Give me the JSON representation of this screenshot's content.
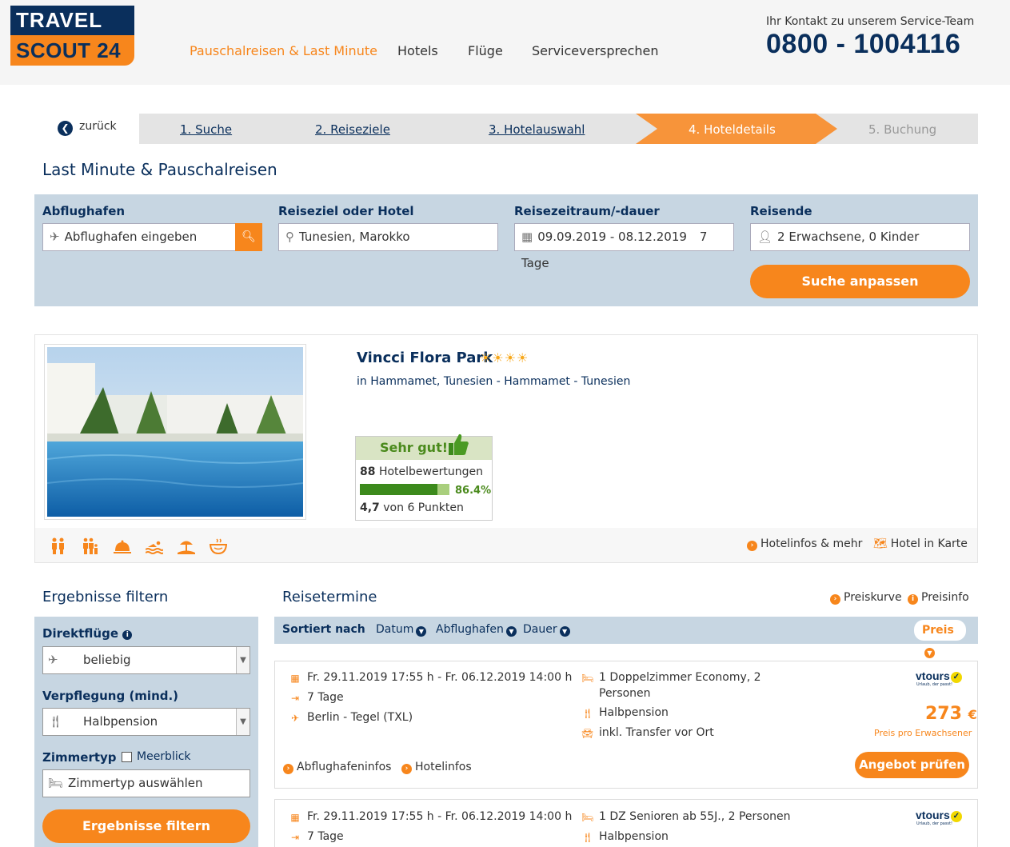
{
  "header": {
    "logo_top": "TRAVEL",
    "logo_bottom": "SCOUT 24",
    "nav": [
      "Pauschalreisen & Last Minute",
      "Hotels",
      "Flüge",
      "Serviceversprechen"
    ],
    "contact_label": "Ihr Kontakt zu unserem Service-Team",
    "contact_phone": "0800 - 1004116"
  },
  "steps": {
    "back_label": "zurück",
    "items": [
      "1. Suche",
      "2. Reiseziele",
      "3. Hotelauswahl",
      "4. Hoteldetails",
      "5. Buchung"
    ],
    "active_index": 3
  },
  "page_title": "Last Minute & Pauschalreisen",
  "search": {
    "departure_label": "Abflughafen",
    "departure_placeholder": "Abflughafen eingeben",
    "destination_label": "Reiseziel oder Hotel",
    "destination_value": "Tunesien, Marokko",
    "period_label": "Reisezeitraum/-dauer",
    "period_value": "09.09.2019 - 08.12.2019",
    "duration_value": "7 Tage",
    "travelers_label": "Reisende",
    "travelers_value": "2 Erwachsene, 0 Kinder",
    "submit_label": "Suche anpassen"
  },
  "hotel": {
    "name": "Vincci Flora Park",
    "stars": 4,
    "stars_text": "☀☀☀☀",
    "location": "in Hammamet, Tunesien - Hammamet - Tunesien",
    "rating_title": "Sehr gut!",
    "review_count": "88",
    "review_label": "Hotelbewertungen",
    "recommend_pct": "86.4%",
    "recommend_fraction": 0.864,
    "score": "4,7",
    "score_suffix": "von 6 Punkten",
    "link_info": "Hotelinfos & mehr",
    "link_map": "Hotel in Karte",
    "amenity_icons": [
      "family-icon",
      "family-kids-icon",
      "service-bell-icon",
      "swimming-icon",
      "beach-icon",
      "food-bowl-icon"
    ]
  },
  "filter": {
    "title": "Ergebnisse filtern",
    "direct_label": "Direktflüge",
    "direct_value": "beliebig",
    "board_label": "Verpflegung (mind.)",
    "board_value": "Halbpension",
    "room_label": "Zimmertyp",
    "seaview_label": "Meerblick",
    "room_placeholder": "Zimmertyp auswählen",
    "submit_label": "Ergebnisse filtern"
  },
  "results": {
    "title": "Reisetermine",
    "link_pricecurve": "Preiskurve",
    "link_priceinfo": "Preisinfo",
    "sort_label": "Sortiert nach",
    "sort_options": [
      "Datum",
      "Abflughafen",
      "Dauer"
    ],
    "sort_active": "Preis",
    "offers": [
      {
        "dates": "Fr. 29.11.2019 17:55 h - Fr. 06.12.2019 14:00 h",
        "duration": "7 Tage",
        "airport": "Berlin - Tegel (TXL)",
        "room_line1": "1 Doppelzimmer Economy, 2",
        "room_line2": "Personen",
        "board": "Halbpension",
        "transfer": "inkl. Transfer vor Ort",
        "operator": "vtours",
        "operator_tagline": "Urlaub, der passt!",
        "price": "273",
        "currency": "€",
        "price_note": "Preis pro Erwachsener",
        "link_airport": "Abflughafeninfos",
        "link_hotel": "Hotelinfos",
        "cta": "Angebot prüfen"
      },
      {
        "dates": "Fr. 29.11.2019 17:55 h - Fr. 06.12.2019 14:00 h",
        "duration": "7 Tage",
        "room_line1": "1 DZ Senioren ab 55J., 2 Personen",
        "board": "Halbpension",
        "operator": "vtours",
        "operator_tagline": "Urlaub, der passt!"
      }
    ]
  },
  "colors": {
    "brand_navy": "#0a2f5c",
    "brand_orange": "#f7861c",
    "panel_blue": "#c7d6e2",
    "rating_green": "#3c8a1c"
  }
}
